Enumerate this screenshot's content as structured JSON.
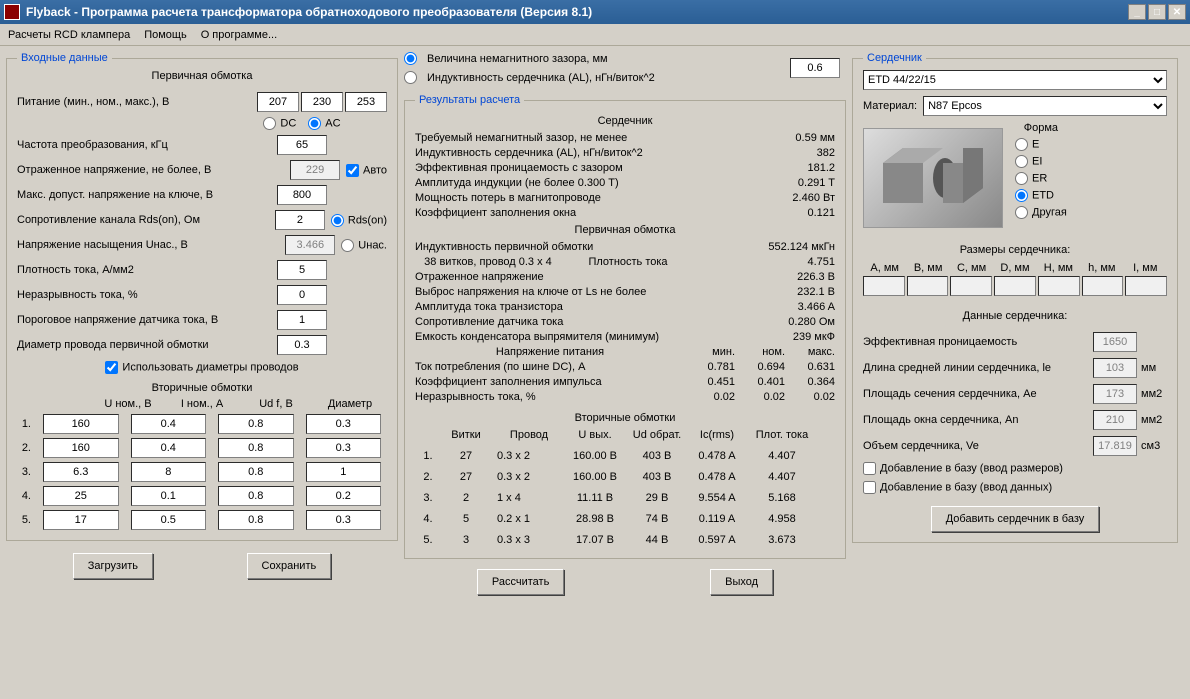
{
  "window": {
    "title": "Flyback - Программа расчета трансформатора обратноходового преобразователя (Версия 8.1)"
  },
  "menu": {
    "rcd": "Расчеты RCD клампера",
    "help": "Помощь",
    "about": "О программе..."
  },
  "inputs": {
    "legend": "Входные данные",
    "primary_title": "Первичная обмотка",
    "supply_label": "Питание (мин., ном., макс.), В",
    "supply_min": "207",
    "supply_nom": "230",
    "supply_max": "253",
    "dc": "DC",
    "ac": "AC",
    "freq_label": "Частота преобразования, кГц",
    "freq": "65",
    "vrefl_label": "Отраженное напряжение, не более, В",
    "vrefl": "229",
    "auto": "Авто",
    "vsw_label": "Макс. допуст. напряжение на ключе, В",
    "vsw": "800",
    "rds_label": "Сопротивление канала Rds(on), Ом",
    "rds": "2",
    "rds_radio": "Rds(on)",
    "unas_label": "Напряжение насыщения Uнас., В",
    "unas": "3.466",
    "unas_radio": "Uнас.",
    "jdens_label": "Плотность тока, А/мм2",
    "jdens": "5",
    "irip_label": "Неразрывность тока, %",
    "irip": "0",
    "vsens_label": "Пороговое напряжение датчика тока, В",
    "vsens": "1",
    "dwire_label": "Диаметр провода первичной обмотки",
    "dwire": "0.3",
    "use_diam": "Использовать диаметры проводов",
    "sec_title": "Вторичные обмотки",
    "hdr_u": "U ном., В",
    "hdr_i": "I ном., А",
    "hdr_udf": "Ud f, В",
    "hdr_d": "Диаметр",
    "sec": [
      {
        "u": "160",
        "i": "0.4",
        "udf": "0.8",
        "d": "0.3"
      },
      {
        "u": "160",
        "i": "0.4",
        "udf": "0.8",
        "d": "0.3"
      },
      {
        "u": "6.3",
        "i": "8",
        "udf": "0.8",
        "d": "1"
      },
      {
        "u": "25",
        "i": "0.1",
        "udf": "0.8",
        "d": "0.2"
      },
      {
        "u": "17",
        "i": "0.5",
        "udf": "0.8",
        "d": "0.3"
      }
    ],
    "btn_load": "Загрузить",
    "btn_save": "Сохранить"
  },
  "mid": {
    "gap_radio": "Величина немагнитного зазора, мм",
    "al_radio": "Индуктивность сердечника (AL), нГн/виток^2",
    "gap_val": "0.6",
    "results_legend": "Результаты расчета",
    "core_title": "Сердечник",
    "r1": {
      "l": "Требуемый немагнитный зазор, не менее",
      "v": "0.59 мм"
    },
    "r2": {
      "l": "Индуктивность сердечника (AL), нГн/виток^2",
      "v": "382"
    },
    "r3": {
      "l": "Эффективная проницаемость с зазором",
      "v": "181.2"
    },
    "r4": {
      "l": "Амплитуда индукции               (не более 0.300 T)",
      "v": "0.291 T"
    },
    "r5": {
      "l": "Мощность потерь в магнитопроводе",
      "v": "2.460 Вт"
    },
    "r6": {
      "l": "Коэффициент заполнения окна",
      "v": "0.121"
    },
    "prim_title": "Первичная обмотка",
    "p1": {
      "l": "Индуктивность первичной обмотки",
      "v": "552.124 мкГн"
    },
    "p2": {
      "l": "   38 витков, провод 0.3 x 4            Плотность тока",
      "v": "4.751"
    },
    "p3": {
      "l": "Отраженное напряжение",
      "v": "226.3 В"
    },
    "p4": {
      "l": "Выброс напряжения на ключе от Ls не более",
      "v": "232.1 В"
    },
    "p5": {
      "l": "Амплитуда тока транзистора",
      "v": "3.466 A"
    },
    "p6": {
      "l": "Сопротивление датчика тока",
      "v": "0.280 Ом"
    },
    "p7": {
      "l": "Емкость конденсатора выпрямителя (минимум)",
      "v": "239 мкФ"
    },
    "volt_title": "Напряжение питания",
    "hdr_min": "мин.",
    "hdr_nom": "ном.",
    "hdr_max": "макс.",
    "v1": {
      "l": "Ток потребления (по шине DC), А",
      "min": "0.781",
      "nom": "0.694",
      "max": "0.631"
    },
    "v2": {
      "l": "Коэффициент заполнения импульса",
      "min": "0.451",
      "nom": "0.401",
      "max": "0.364"
    },
    "v3": {
      "l": "Неразрывность тока, %",
      "min": "0.02",
      "nom": "0.02",
      "max": "0.02"
    },
    "sec_title": "Вторичные обмотки",
    "sh": {
      "turns": "Витки",
      "wire": "Провод",
      "uout": "U вых.",
      "urev": "Ud обрат.",
      "irms": "Ic(rms)",
      "j": "Плот. тока"
    },
    "sres": [
      {
        "n": "1.",
        "t": "27",
        "w": "0.3 x 2",
        "u": "160.00 В",
        "r": "403 В",
        "i": "0.478 A",
        "j": "4.407"
      },
      {
        "n": "2.",
        "t": "27",
        "w": "0.3 x 2",
        "u": "160.00 В",
        "r": "403 В",
        "i": "0.478 A",
        "j": "4.407"
      },
      {
        "n": "3.",
        "t": "2",
        "w": "1 x 4",
        "u": "11.11 В",
        "r": "29 В",
        "i": "9.554 A",
        "j": "5.168"
      },
      {
        "n": "4.",
        "t": "5",
        "w": "0.2 x 1",
        "u": "28.98 В",
        "r": "74 В",
        "i": "0.119 A",
        "j": "4.958"
      },
      {
        "n": "5.",
        "t": "3",
        "w": "0.3 x 3",
        "u": "17.07 В",
        "r": "44 В",
        "i": "0.597 A",
        "j": "3.673"
      }
    ],
    "btn_calc": "Рассчитать",
    "btn_exit": "Выход"
  },
  "core": {
    "legend": "Сердечник",
    "core_sel": "ETD 44/22/15",
    "mat_label": "Материал:",
    "mat_sel": "N87 Epcos",
    "shape_label": "Форма",
    "shapes": {
      "e": "E",
      "ei": "EI",
      "er": "ER",
      "etd": "ETD",
      "other": "Другая"
    },
    "dims_title": "Размеры сердечника:",
    "dh": {
      "a": "A, мм",
      "b": "B, мм",
      "c": "C, мм",
      "d": "D, мм",
      "h": "H, мм",
      "hh": "h, мм",
      "i": "I, мм"
    },
    "data_title": "Данные сердечника:",
    "d1": {
      "l": "Эффективная проницаемость",
      "v": "1650",
      "u": ""
    },
    "d2": {
      "l": "Длина средней линии сердечника, le",
      "v": "103",
      "u": "мм"
    },
    "d3": {
      "l": "Площадь сечения сердечника, Ae",
      "v": "173",
      "u": "мм2"
    },
    "d4": {
      "l": "Площадь окна сердечника, An",
      "v": "210",
      "u": "мм2"
    },
    "d5": {
      "l": "Объем сердечника, Ve",
      "v": "17.819",
      "u": "см3"
    },
    "cb1": "Добавление в базу (ввод размеров)",
    "cb2": "Добавление в базу (ввод данных)",
    "btn_add": "Добавить сердечник в базу"
  }
}
